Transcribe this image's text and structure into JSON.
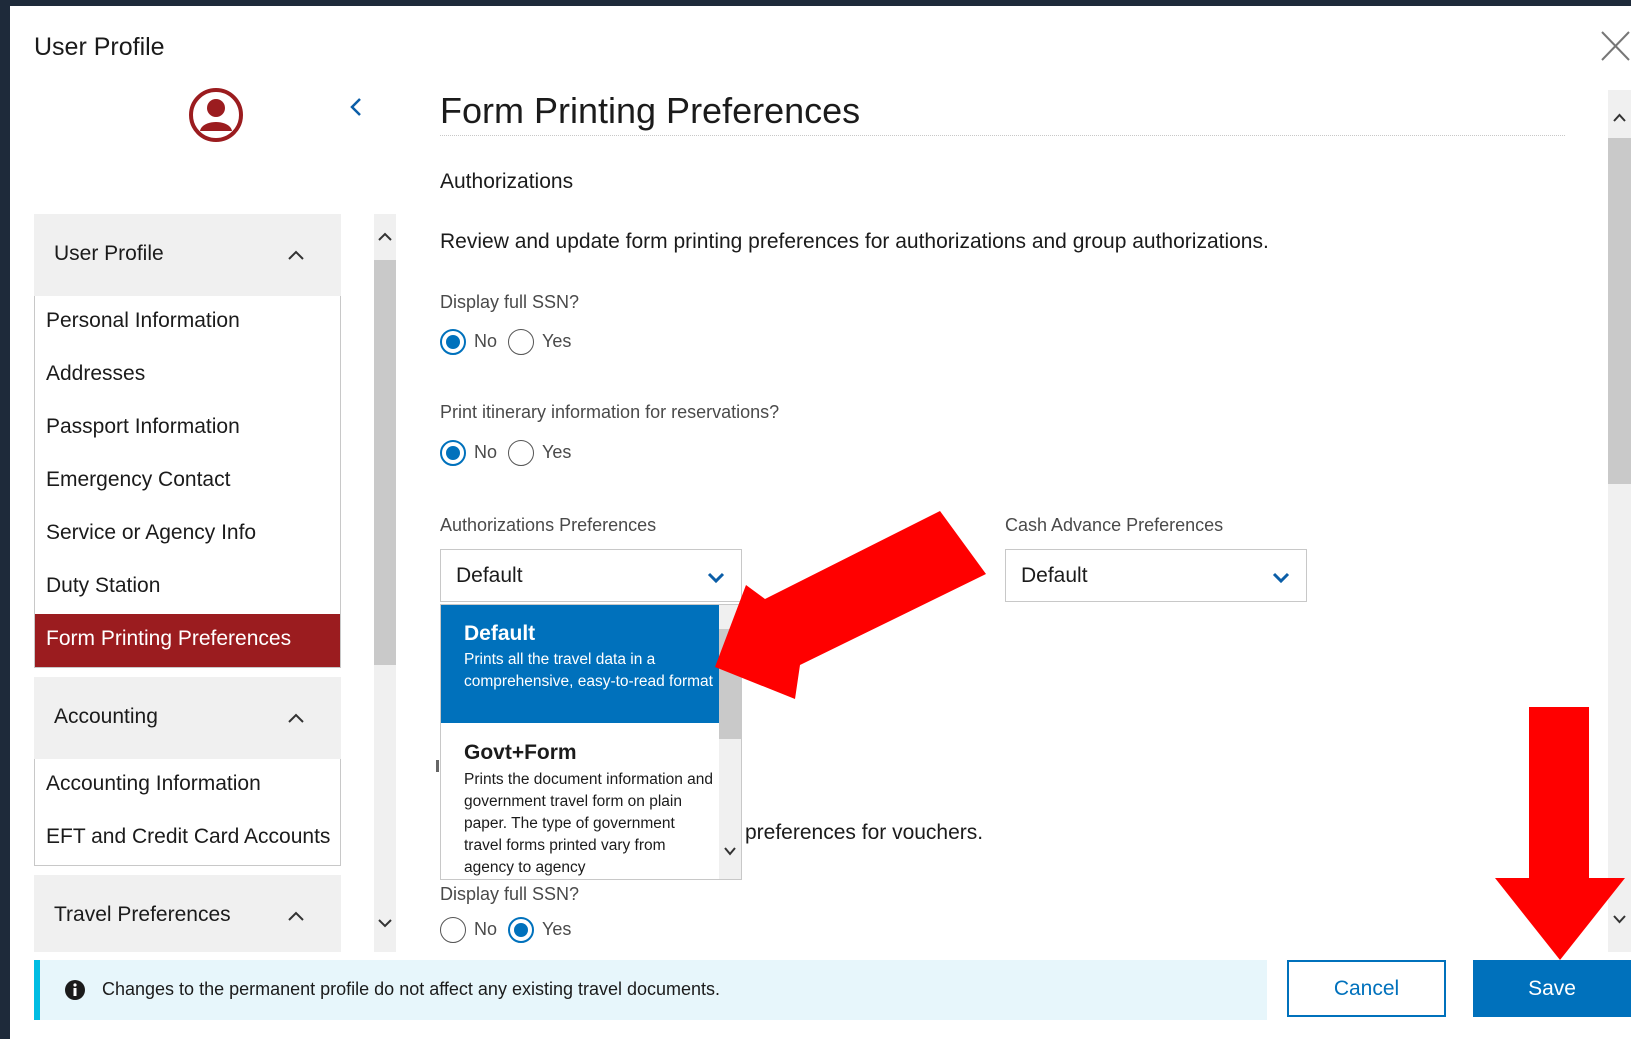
{
  "dialog": {
    "title": "User Profile"
  },
  "sidebar": {
    "sections": [
      {
        "label": "User Profile",
        "items": [
          {
            "label": "Personal Information"
          },
          {
            "label": "Addresses"
          },
          {
            "label": "Passport Information"
          },
          {
            "label": "Emergency Contact"
          },
          {
            "label": "Service or Agency Info"
          },
          {
            "label": "Duty Station"
          },
          {
            "label": "Form Printing Preferences",
            "active": true
          }
        ]
      },
      {
        "label": "Accounting",
        "items": [
          {
            "label": "Accounting Information"
          },
          {
            "label": "EFT and Credit Card Accounts"
          }
        ]
      },
      {
        "label": "Travel Preferences"
      }
    ]
  },
  "main": {
    "title": "Form Printing Preferences",
    "authorizations": {
      "heading": "Authorizations",
      "intro": "Review and update form printing preferences for authorizations and group authorizations.",
      "ssn": {
        "label": "Display full SSN?",
        "no": "No",
        "yes": "Yes",
        "selected": "No"
      },
      "itinerary": {
        "label": "Print itinerary information for reservations?",
        "no": "No",
        "yes": "Yes",
        "selected": "No"
      },
      "auth_pref": {
        "label": "Authorizations Preferences",
        "value": "Default"
      },
      "cash_pref": {
        "label": "Cash Advance Preferences",
        "value": "Default"
      },
      "dropdown_options": [
        {
          "title": "Default",
          "desc": "Prints all the travel data in a comprehensive, easy-to-read format",
          "selected": true
        },
        {
          "title": "Govt+Form",
          "desc": "Prints the document information and government travel form on plain paper. The type of government travel forms printed vary from agency to agency",
          "selected": false
        }
      ]
    },
    "vouchers": {
      "intro_visible": "preferences for vouchers.",
      "ssn": {
        "label": "Display full SSN?",
        "no": "No",
        "yes": "Yes",
        "selected": "Yes"
      }
    }
  },
  "footer": {
    "info": "Changes to the permanent profile do not affect any existing travel documents.",
    "cancel": "Cancel",
    "save": "Save"
  },
  "colors": {
    "accent": "#0071bc",
    "active_nav": "#9b1c1f",
    "annotation_arrow": "#ff0000",
    "info_border": "#00bde3"
  },
  "icons": [
    "close-icon",
    "user-avatar-icon",
    "chevron-left-icon",
    "chevron-up-icon",
    "chevron-down-icon",
    "info-icon"
  ]
}
